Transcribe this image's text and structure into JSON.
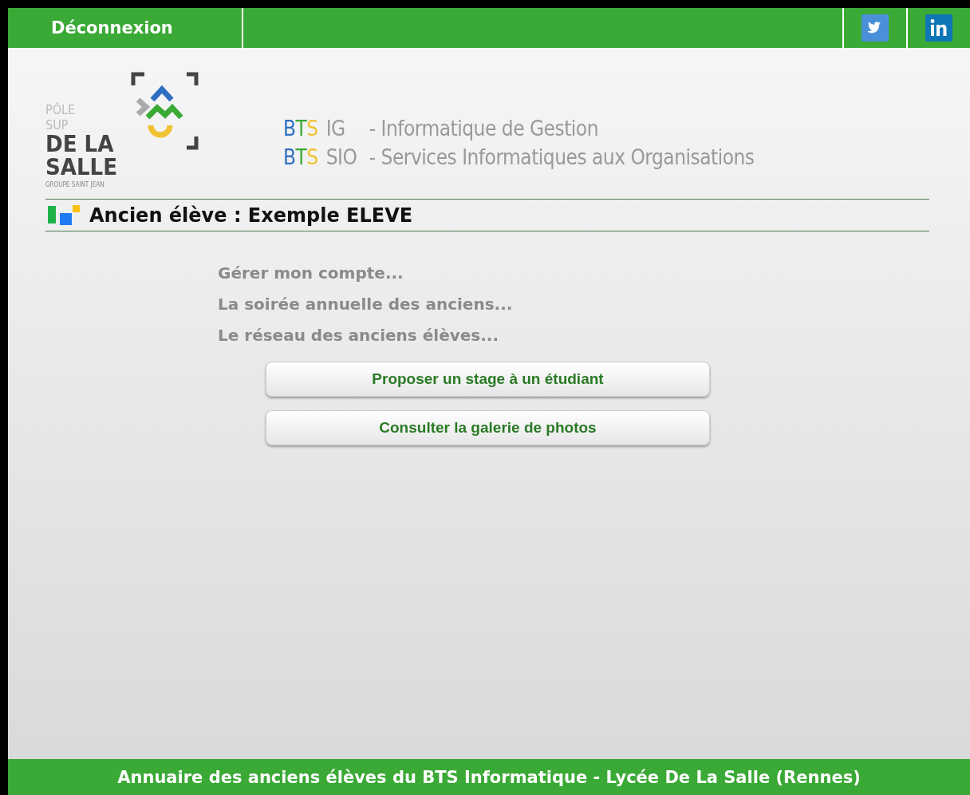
{
  "top_bar": {
    "logout": "Déconnexion",
    "social": [
      {
        "kind": "twitter"
      },
      {
        "kind": "linkedin"
      }
    ]
  },
  "logo": {
    "lines": [
      "PÔLE",
      "SUP",
      "DE LA",
      "SALLE",
      "GROUPE SAINT JEAN"
    ]
  },
  "programs": [
    {
      "code": "BTS",
      "option": "IG",
      "description": "- Informatique de Gestion"
    },
    {
      "code": "BTS",
      "option": "SIO",
      "description": "- Services Informatiques aux Organisations"
    }
  ],
  "heading": "Ancien élève : Exemple ELEVE",
  "links": [
    "Gérer mon compte...",
    "La soirée annuelle des anciens...",
    "Le réseau des anciens élèves..."
  ],
  "buttons": [
    "Proposer un stage à un étudiant",
    "Consulter la galerie de photos"
  ],
  "footer": "Annuaire des anciens élèves du BTS Informatique - Lycée De La Salle (Rennes)"
}
